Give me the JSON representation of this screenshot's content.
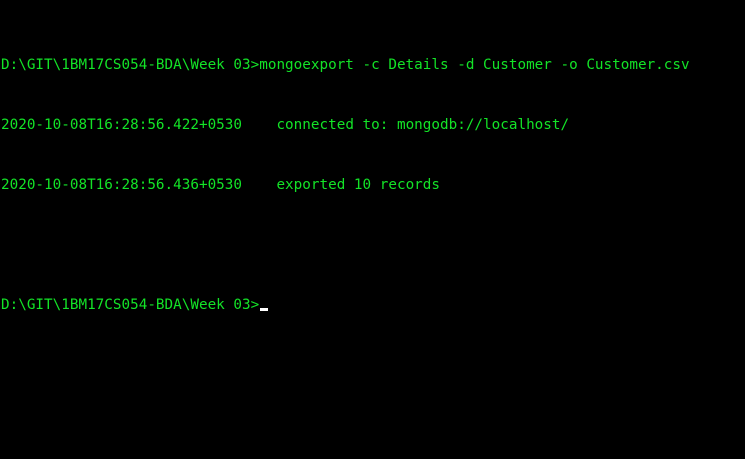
{
  "terminal": {
    "prompt": "D:\\GIT\\1BM17CS054-BDA\\Week 03>",
    "command": "mongoexport -c Details -d Customer -o Customer.csv",
    "logs": [
      {
        "timestamp": "2020-10-08T16:28:56.422+0530",
        "message": "connected to: mongodb://localhost/"
      },
      {
        "timestamp": "2020-10-08T16:28:56.436+0530",
        "message": "exported 10 records"
      }
    ],
    "text_color": "#13E327",
    "background_color": "#000000",
    "cursor_color": "#FFFFFF"
  }
}
